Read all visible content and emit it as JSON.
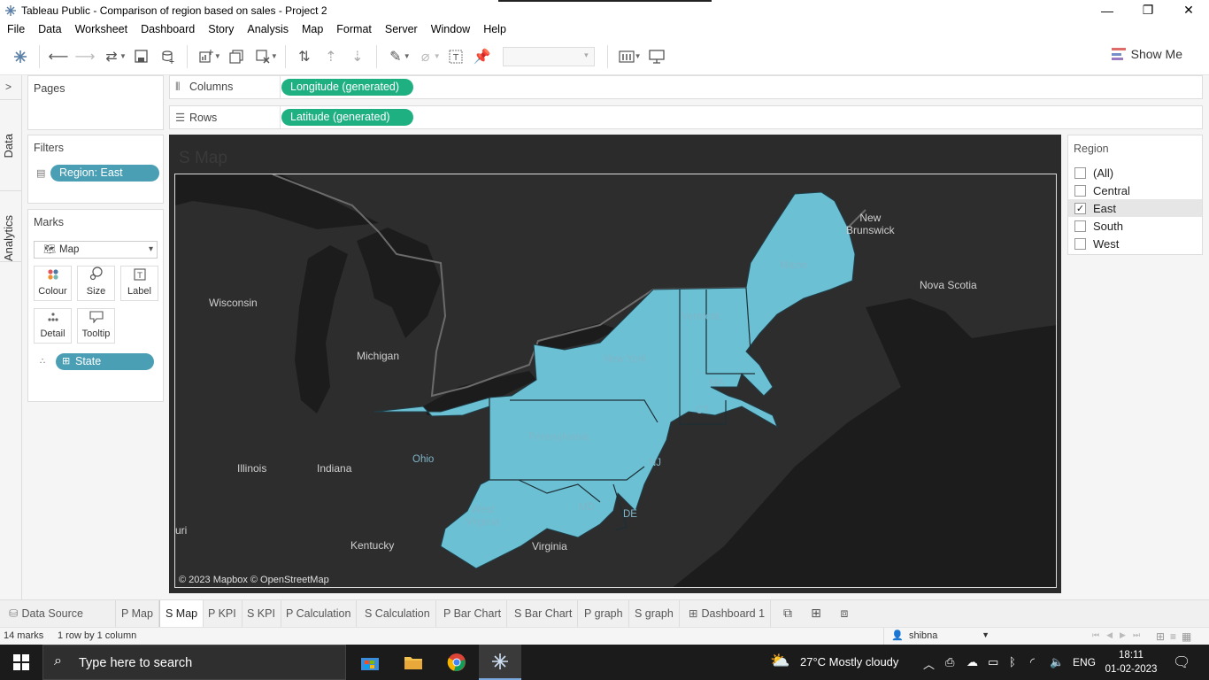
{
  "window": {
    "title": "Tableau Public - Comparison of region based on sales - Project 2",
    "minimize": "—",
    "restore": "❐",
    "close": "✕"
  },
  "menu": [
    "File",
    "Data",
    "Worksheet",
    "Dashboard",
    "Story",
    "Analysis",
    "Map",
    "Format",
    "Server",
    "Window",
    "Help"
  ],
  "toolbar": {
    "show_me_label": "Show Me"
  },
  "left_tabs": {
    "data_label": "Data",
    "analytics_label": "Analytics"
  },
  "pages": {
    "title": "Pages"
  },
  "filters": {
    "title": "Filters",
    "pill": "Region: East"
  },
  "marks": {
    "title": "Marks",
    "type": "Map",
    "buttons": {
      "colour": "Colour",
      "size": "Size",
      "label": "Label",
      "detail": "Detail",
      "tooltip": "Tooltip"
    },
    "field_pill": "State"
  },
  "shelves": {
    "columns_label": "Columns",
    "columns_pill": "Longitude (generated)",
    "rows_label": "Rows",
    "rows_pill": "Latitude (generated)"
  },
  "view": {
    "title": "S Map",
    "attribution": "© 2023 Mapbox © OpenStreetMap",
    "map_labels": {
      "wisconsin": "Wisconsin",
      "michigan": "Michigan",
      "illinois": "Illinois",
      "indiana": "Indiana",
      "kentucky": "Kentucky",
      "virginia": "Virginia",
      "new_brunswick": "New\nBrunswick",
      "nova_scotia": "Nova Scotia",
      "uri": "uri",
      "ohio": "Ohio",
      "west_virginia": "West\nVirginia",
      "pennsylvania": "Pennsylvania",
      "new_york": "New York",
      "maine": "Maine",
      "vermont": "Vermont",
      "ma": "MA",
      "ct": "CT",
      "nj": "NJ",
      "de": "DE",
      "md": "MD"
    },
    "colors": {
      "highlight": "#6cc0d4",
      "land": "#2d2d2d",
      "water": "#1c1c1c"
    }
  },
  "region_filter": {
    "title": "Region",
    "options": [
      {
        "label": "(All)",
        "checked": false
      },
      {
        "label": "Central",
        "checked": false
      },
      {
        "label": "East",
        "checked": true
      },
      {
        "label": "South",
        "checked": false
      },
      {
        "label": "West",
        "checked": false
      }
    ],
    "check_glyph": "✓"
  },
  "sheet_tabs": [
    "Data Source",
    "P Map",
    "S Map",
    "P KPI",
    "S KPI",
    "P Calculation",
    "S Calculation",
    "P Bar Chart",
    "S Bar Chart",
    "P graph",
    "S graph",
    "Dashboard 1"
  ],
  "active_sheet": "S Map",
  "status": {
    "marks": "14 marks",
    "dims": "1 row by 1 column",
    "user": "shibna"
  },
  "taskbar": {
    "search_placeholder": "Type here to search",
    "weather": "27°C  Mostly cloudy",
    "lang": "ENG",
    "time": "18:11",
    "date": "01-02-2023"
  }
}
